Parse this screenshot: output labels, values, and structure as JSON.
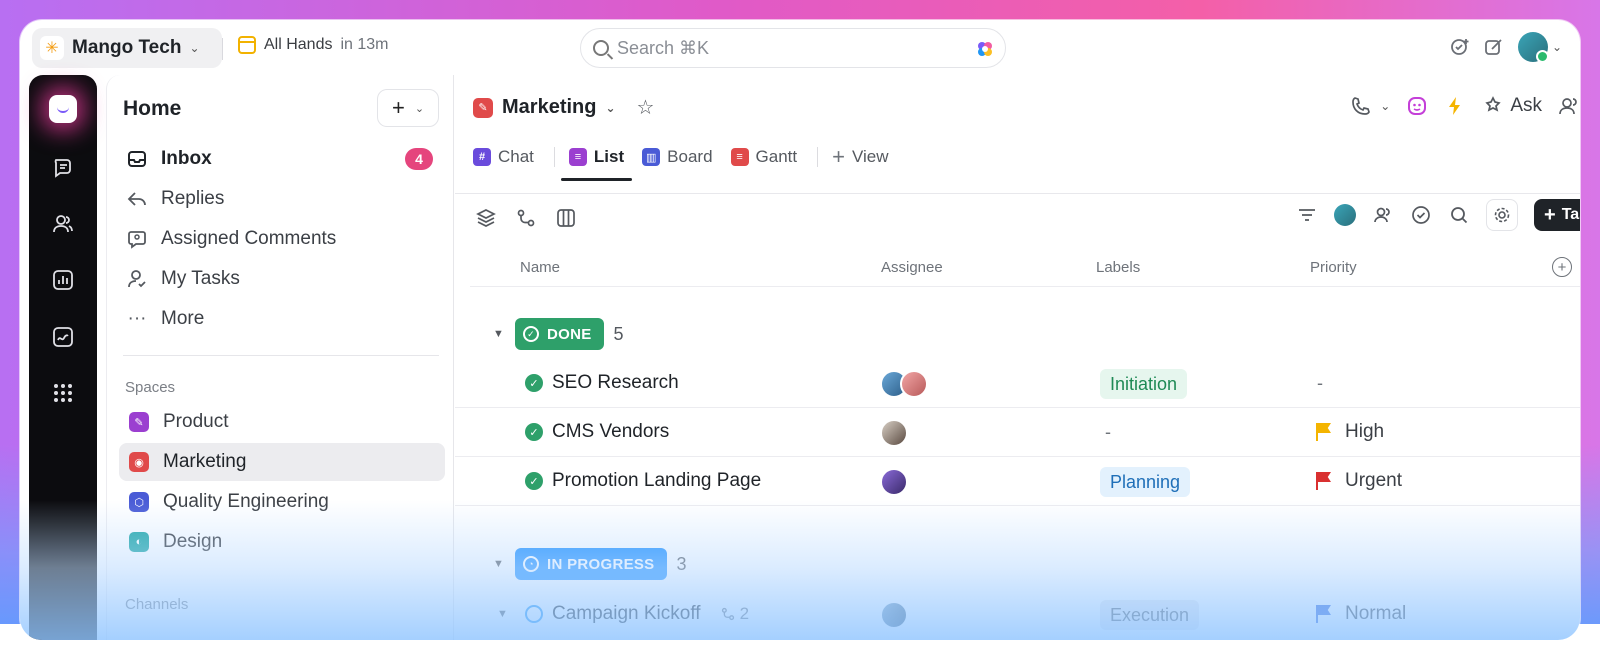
{
  "workspace": {
    "name": "Mango Tech"
  },
  "event": {
    "title": "All Hands",
    "time": "in 13m"
  },
  "search": {
    "placeholder": "Search ⌘K"
  },
  "sidebar": {
    "title": "Home",
    "items": [
      {
        "label": "Inbox",
        "badge": "4"
      },
      {
        "label": "Replies"
      },
      {
        "label": "Assigned Comments"
      },
      {
        "label": "My Tasks"
      },
      {
        "label": "More"
      }
    ],
    "spaces_heading": "Spaces",
    "spaces": [
      {
        "label": "Product",
        "color": "#9b3fd0"
      },
      {
        "label": "Marketing",
        "color": "#e04a4a"
      },
      {
        "label": "Quality Engineering",
        "color": "#4a5bd6"
      },
      {
        "label": "Design",
        "color": "#1fa7a7"
      }
    ],
    "channels_heading": "Channels"
  },
  "main": {
    "title": "Marketing",
    "ask_label": "Ask",
    "tabs": [
      {
        "label": "Chat",
        "color": "#6a4bdc",
        "glyph": "#"
      },
      {
        "label": "List",
        "color": "#9b3fd0",
        "glyph": "≡"
      },
      {
        "label": "Board",
        "color": "#4a5bd6",
        "glyph": "▥"
      },
      {
        "label": "Gantt",
        "color": "#e04a4a",
        "glyph": "≡"
      }
    ],
    "add_view_label": "View",
    "task_button_label": "Task"
  },
  "table": {
    "columns": {
      "name": "Name",
      "assignee": "Assignee",
      "labels": "Labels",
      "priority": "Priority"
    },
    "groups": [
      {
        "status": "DONE",
        "count": "5",
        "color": "#2ea06a",
        "rows": [
          {
            "name": "SEO Research",
            "label": "Initiation",
            "priority": "-"
          },
          {
            "name": "CMS Vendors",
            "label": "-",
            "priority": "High"
          },
          {
            "name": "Promotion Landing Page",
            "label": "Planning",
            "priority": "Urgent"
          }
        ]
      },
      {
        "status": "IN PROGRESS",
        "count": "3",
        "color": "#1e90ff",
        "rows": [
          {
            "name": "Campaign Kickoff",
            "subtasks": "2",
            "label": "Execution",
            "priority": "Normal"
          }
        ]
      }
    ]
  },
  "colors": {
    "flag_high": "#f4b400",
    "flag_urgent": "#d93030",
    "flag_normal": "#2b5fd9",
    "label_initiation_bg": "#e6f6ee",
    "label_initiation_fg": "#1e8a55",
    "label_planning_bg": "#e3f1fd",
    "label_planning_fg": "#1f6fb8",
    "label_execution_bg": "#e9e9ee",
    "label_execution_fg": "#55595f"
  }
}
